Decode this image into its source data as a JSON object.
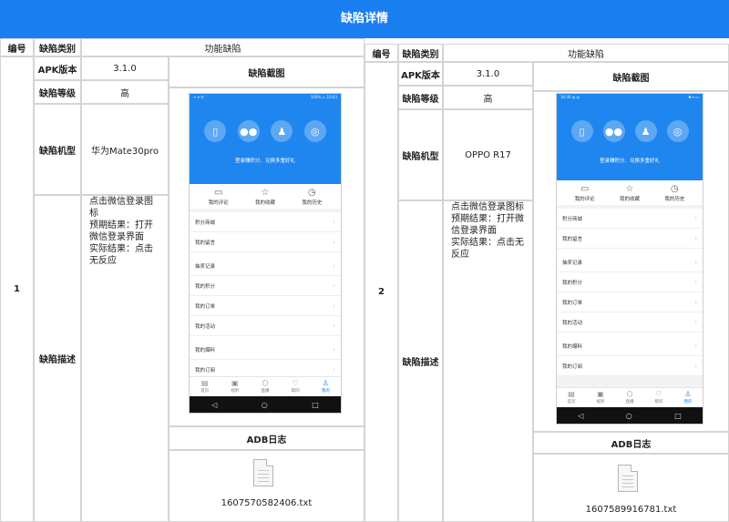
{
  "title": "缺陷详情",
  "headers": {
    "number": "编号",
    "category": "缺陷类别"
  },
  "labels": {
    "apk_version": "APK版本",
    "level": "缺陷等级",
    "model": "缺陷机型",
    "description": "缺陷描述",
    "screenshot": "缺陷截图",
    "adb_log": "ADB日志"
  },
  "defects": [
    {
      "number": "1",
      "category": "功能缺陷",
      "apk_version": "3.1.0",
      "level": "高",
      "model": "华为Mate30pro",
      "description": [
        "点击微信登录图标",
        "预期结果：打开微信登录界面",
        "实际结果：点击无反应"
      ],
      "log_file": "1607570582406.txt",
      "phone": {
        "status_left": "ᯤ ▾ ✉",
        "status_right": "100% ▭ 10:03",
        "slogan": "登录赚积分、兑换多重好礼",
        "tabs": [
          "我的评论",
          "我的收藏",
          "我的历史"
        ],
        "menu": [
          "积分商城",
          "我的留言",
          "抽奖记录",
          "我的积分",
          "我的订单",
          "我的活动",
          "我的爆料",
          "我的订阅"
        ],
        "bottom": [
          "首页",
          "视听",
          "直播",
          "帮问",
          "我的"
        ]
      }
    },
    {
      "number": "2",
      "category": "功能缺陷",
      "apk_version": "3.1.0",
      "level": "高",
      "model": "OPPO R17",
      "description": [
        "点击微信登录图标",
        "预期结果：打开微信登录界面",
        "实际结果：点击无反应"
      ],
      "log_file": "1607589916781.txt",
      "phone": {
        "status_left": "16:46 ◍ ◍",
        "status_right": "✱ ▾ ▭",
        "slogan": "登录赚积分、兑换多重好礼",
        "tabs": [
          "我的评论",
          "我的收藏",
          "我的历史"
        ],
        "menu": [
          "积分商城",
          "我的留言",
          "抽奖记录",
          "我的积分",
          "我的订单",
          "我的活动",
          "我的爆料",
          "我的订阅"
        ],
        "bottom": [
          "首页",
          "视听",
          "直播",
          "帮问",
          "我的"
        ]
      }
    }
  ]
}
